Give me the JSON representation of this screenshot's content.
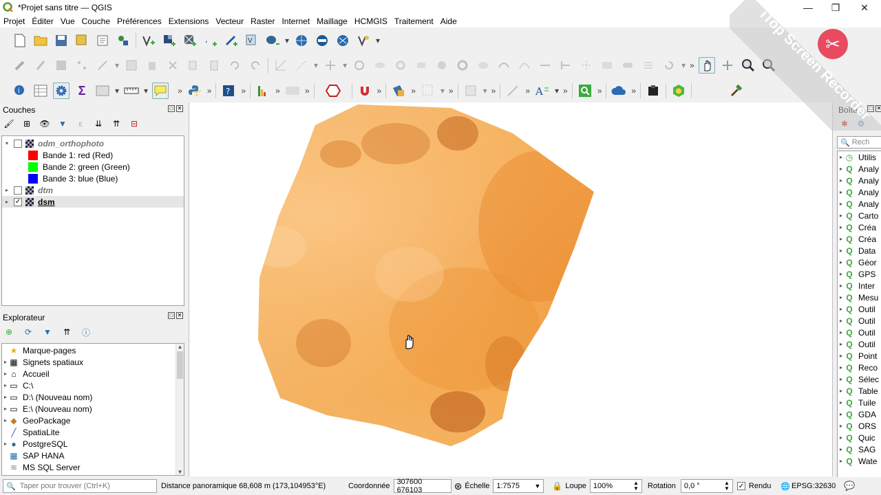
{
  "window": {
    "title": "*Projet sans titre — QGIS",
    "controls": {
      "minimize": "—",
      "restore": "❐",
      "close": "✕"
    }
  },
  "menu": [
    "Projet",
    "Éditer",
    "Vue",
    "Couche",
    "Préférences",
    "Extensions",
    "Vecteur",
    "Raster",
    "Internet",
    "Maillage",
    "HCMGIS",
    "Traitement",
    "Aide"
  ],
  "layers_panel": {
    "title": "Couches",
    "layers": [
      {
        "name": "odm_orthophoto",
        "checked": false,
        "expanded": true,
        "style": "italic"
      },
      {
        "name": "dtm",
        "checked": false,
        "expanded": false,
        "style": "italic"
      },
      {
        "name": "dsm",
        "checked": true,
        "expanded": false,
        "style": "bold"
      }
    ],
    "bands": [
      {
        "label": "Bande 1: red (Red)",
        "color": "#ff0000"
      },
      {
        "label": "Bande 2: green (Green)",
        "color": "#00ff00"
      },
      {
        "label": "Bande 3: blue (Blue)",
        "color": "#0000ff"
      }
    ]
  },
  "browser_panel": {
    "title": "Explorateur",
    "items": [
      "Marque-pages",
      "Signets spatiaux",
      "Accueil",
      "C:\\",
      "D:\\ (Nouveau nom)",
      "E:\\ (Nouveau nom)",
      "GeoPackage",
      "SpatiaLite",
      "PostgreSQL",
      "SAP HANA",
      "MS SQL Server"
    ]
  },
  "toolbox_panel": {
    "title": "Boîte",
    "search_placeholder": "Rech",
    "items": [
      "Utilis",
      "Analy",
      "Analy",
      "Analy",
      "Analy",
      "Carto",
      "Créa",
      "Créa",
      "Data",
      "Géor",
      "GPS",
      "Inter",
      "Mesu",
      "Outil",
      "Outil",
      "Outil",
      "Outil",
      "Point",
      "Reco",
      "Sélec",
      "Table",
      "Tuile",
      "GDA",
      "ORS",
      "Quic",
      "SAG",
      "Wate"
    ]
  },
  "status": {
    "search_placeholder": "Taper pour trouver (Ctrl+K)",
    "message": "Distance panoramique 68,608 m (173,104953°E)",
    "coord_label": "Coordonnée",
    "coord_value": "307600 676103",
    "scale_label": "Échelle",
    "scale_value": "1:7575",
    "magnifier_label": "Loupe",
    "magnifier_value": "100%",
    "rotation_label": "Rotation",
    "rotation_value": "0,0 °",
    "render_label": "Rendu",
    "crs": "EPSG:32630"
  },
  "watermark": "iTop Screen Recorder"
}
